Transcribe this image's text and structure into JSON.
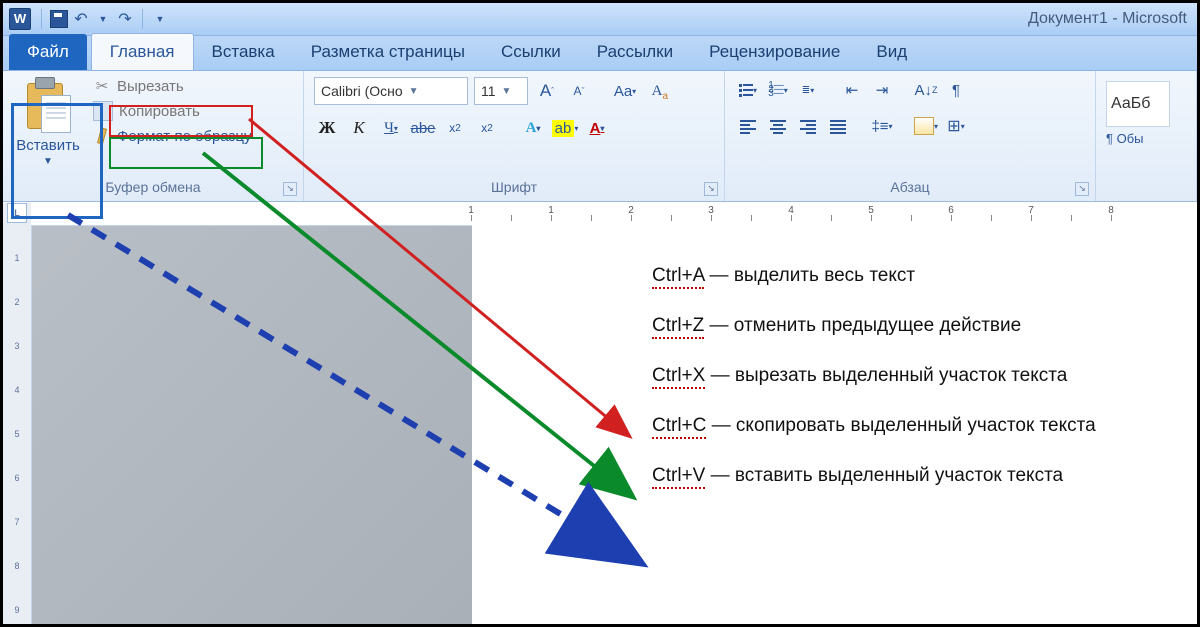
{
  "title": "Документ1 - Microsoft",
  "tabs": {
    "file": "Файл",
    "home": "Главная",
    "insert": "Вставка",
    "layout": "Разметка страницы",
    "refs": "Ссылки",
    "mail": "Рассылки",
    "review": "Рецензирование",
    "view": "Вид"
  },
  "clipboard": {
    "paste": "Вставить",
    "cut": "Вырезать",
    "copy": "Копировать",
    "format": "Формат по образцу",
    "group": "Буфер обмена"
  },
  "font": {
    "name": "Calibri (Осно",
    "size": "11",
    "group": "Шрифт",
    "clear": "Aa",
    "grow": "A",
    "shrink": "A"
  },
  "para": {
    "group": "Абзац"
  },
  "styles": {
    "tile": "АаБб",
    "sub": "¶ Обы"
  },
  "shortcuts": [
    {
      "key": "Ctrl+A",
      "desc": " — выделить весь текст"
    },
    {
      "key": "Ctrl+Z",
      "desc": " — отменить предыдущее действие"
    },
    {
      "key": "Ctrl+X",
      "desc": " — вырезать выделенный участок текста"
    },
    {
      "key": "Ctrl+C",
      "desc": " — скопировать выделенный участок текста"
    },
    {
      "key": "Ctrl+V",
      "desc": " — вставить выделенный участок текста"
    }
  ],
  "vruler": [
    "1",
    "·",
    "1",
    "·",
    "2",
    "·",
    "3",
    "·",
    "4",
    "·",
    "5",
    "·",
    "6",
    "·",
    "7",
    "·",
    "8"
  ],
  "vnums": [
    "1",
    "2",
    "3",
    "4",
    "5",
    "6",
    "7",
    "8",
    "9"
  ]
}
